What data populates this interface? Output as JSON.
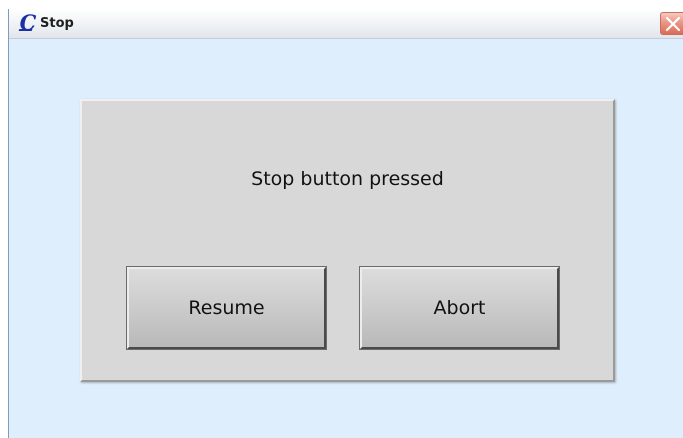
{
  "window": {
    "title": "Stop",
    "icon": "c-logo-icon",
    "close_icon": "close-icon"
  },
  "dialog": {
    "message": "Stop button pressed",
    "resume_label": "Resume",
    "abort_label": "Abort"
  },
  "colors": {
    "window_background": "#dfeefc",
    "panel_background": "#d8d8d8",
    "close_button": "#e27d69",
    "icon_blue": "#1c2fa8"
  }
}
